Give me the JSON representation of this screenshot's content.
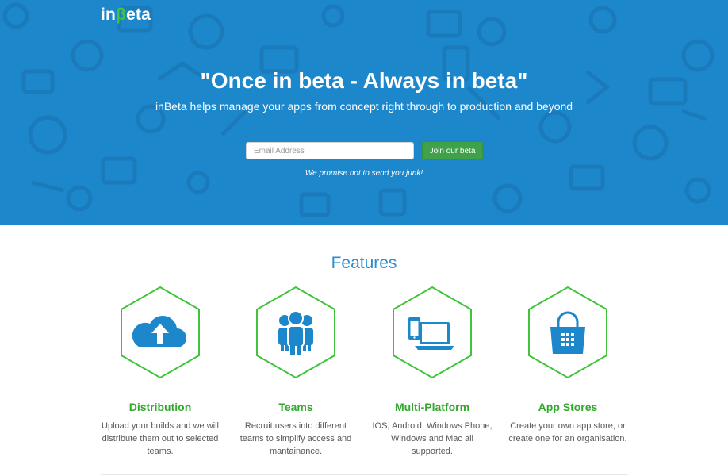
{
  "brand": {
    "logo_prefix": "in",
    "logo_beta": "β",
    "logo_suffix": "eta"
  },
  "hero": {
    "headline": "\"Once in beta - Always in beta\"",
    "subhead": "inBeta helps manage your apps from concept right through to production and beyond",
    "email_placeholder": "Email Address",
    "join_label": "Join our beta",
    "promise": "We promise not to send you junk!"
  },
  "features": {
    "title": "Features",
    "items": [
      {
        "icon": "cloud-upload-icon",
        "title": "Distribution",
        "desc": "Upload your builds and we will distribute them out to selected teams."
      },
      {
        "icon": "team-icon",
        "title": "Teams",
        "desc": "Recruit users into different teams to simplify access and mantainance."
      },
      {
        "icon": "devices-icon",
        "title": "Multi-Platform",
        "desc": "IOS, Android, Windows Phone, Windows and Mac all supported."
      },
      {
        "icon": "shopping-bag-icon",
        "title": "App Stores",
        "desc": "Create your own app store, or create one for an organisation."
      }
    ]
  },
  "colors": {
    "hero_bg": "#1d87cc",
    "accent_green": "#32a82e",
    "features_blue": "#2a8fd0",
    "icon_blue": "#1d87cc"
  }
}
